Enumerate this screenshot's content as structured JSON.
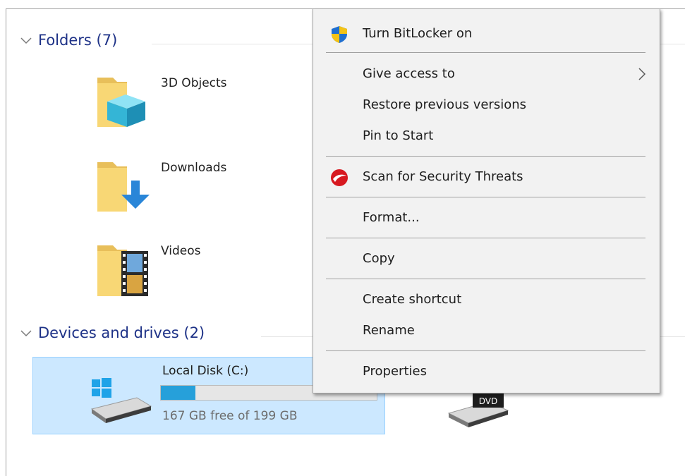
{
  "groups": {
    "folders": {
      "title": "Folders (7)"
    },
    "devices": {
      "title": "Devices and drives (2)"
    }
  },
  "folders": [
    {
      "name": "3D Objects",
      "icon": "3d-objects-folder-icon"
    },
    {
      "name": "Downloads",
      "icon": "downloads-folder-icon"
    },
    {
      "name": "Videos",
      "icon": "videos-folder-icon"
    }
  ],
  "drive": {
    "name": "Local Disk (C:)",
    "free_text": "167 GB free of 199 GB",
    "used_fraction": 0.16,
    "bar_color": "#26a0da",
    "selected_bg": "#cce8ff"
  },
  "dvd_drive": {
    "badge": "DVD"
  },
  "context_menu": {
    "items": [
      {
        "label": "Turn BitLocker on",
        "icon": "bitlocker-shield-icon"
      },
      {
        "label": "Give access to",
        "submenu": true
      },
      {
        "label": "Restore previous versions"
      },
      {
        "label": "Pin to Start"
      },
      {
        "label": "Scan for Security Threats",
        "icon": "trend-micro-icon"
      },
      {
        "label": "Format..."
      },
      {
        "label": "Copy"
      },
      {
        "label": "Create shortcut"
      },
      {
        "label": "Rename"
      },
      {
        "label": "Properties"
      }
    ]
  }
}
